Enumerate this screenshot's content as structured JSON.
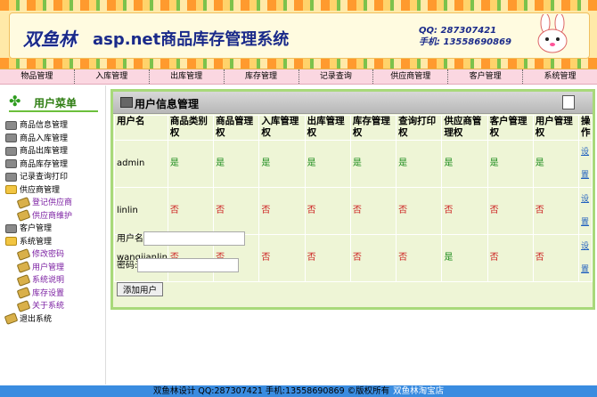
{
  "header": {
    "logo_text": "双鱼林",
    "title": "asp.net商品库存管理系统",
    "qq": "QQ: 287307421",
    "phone": "手机: 13558690869"
  },
  "nav": [
    {
      "label": "物品管理"
    },
    {
      "label": "入库管理"
    },
    {
      "label": "出库管理"
    },
    {
      "label": "库存管理"
    },
    {
      "label": "记录查询"
    },
    {
      "label": "供应商管理"
    },
    {
      "label": "客户管理"
    },
    {
      "label": "系统管理"
    }
  ],
  "sidebar": {
    "title": "用户菜单",
    "items": [
      {
        "label": "商品信息管理"
      },
      {
        "label": "商品入库管理"
      },
      {
        "label": "商品出库管理"
      },
      {
        "label": "商品库存管理"
      },
      {
        "label": "记录查询打印"
      },
      {
        "label": "供应商管理"
      },
      {
        "label": "登记供应商"
      },
      {
        "label": "供应商维护"
      },
      {
        "label": "客户管理"
      },
      {
        "label": "系统管理"
      },
      {
        "label": "修改密码"
      },
      {
        "label": "用户管理"
      },
      {
        "label": "系统说明"
      },
      {
        "label": "库存设置"
      },
      {
        "label": "关于系统"
      },
      {
        "label": "退出系统"
      }
    ]
  },
  "main": {
    "panel_title": "用户信息管理",
    "columns": [
      "用户名",
      "商品类别权",
      "商品管理权",
      "入库管理权",
      "出库管理权",
      "库存管理权",
      "查询打印权",
      "供应商管理权",
      "客户管理权",
      "用户管理权",
      "操作"
    ],
    "rows": [
      {
        "name": "admin",
        "perms": [
          "是",
          "是",
          "是",
          "是",
          "是",
          "是",
          "是",
          "是",
          "是"
        ],
        "action": "设置"
      },
      {
        "name": "linlin",
        "perms": [
          "否",
          "否",
          "否",
          "否",
          "否",
          "否",
          "否",
          "否",
          "否"
        ],
        "action": "设置"
      },
      {
        "name": "wangjianlin",
        "perms": [
          "否",
          "否",
          "否",
          "否",
          "否",
          "否",
          "是",
          "否",
          "否"
        ],
        "action": "设置"
      }
    ],
    "form": {
      "username_label": "用户名",
      "username_value": "",
      "password_label": "密码:",
      "password_value": "",
      "submit_label": "添加用户"
    }
  },
  "footer": {
    "text": "双鱼林设计 QQ:287307421 手机:13558690869 ©版权所有",
    "link": "双鱼林淘宝店"
  },
  "colors": {
    "yes": "#1a8a1a",
    "no": "#cc1f1f",
    "panel_border": "#a8d97a",
    "footer_bg": "#3a8ce0"
  }
}
